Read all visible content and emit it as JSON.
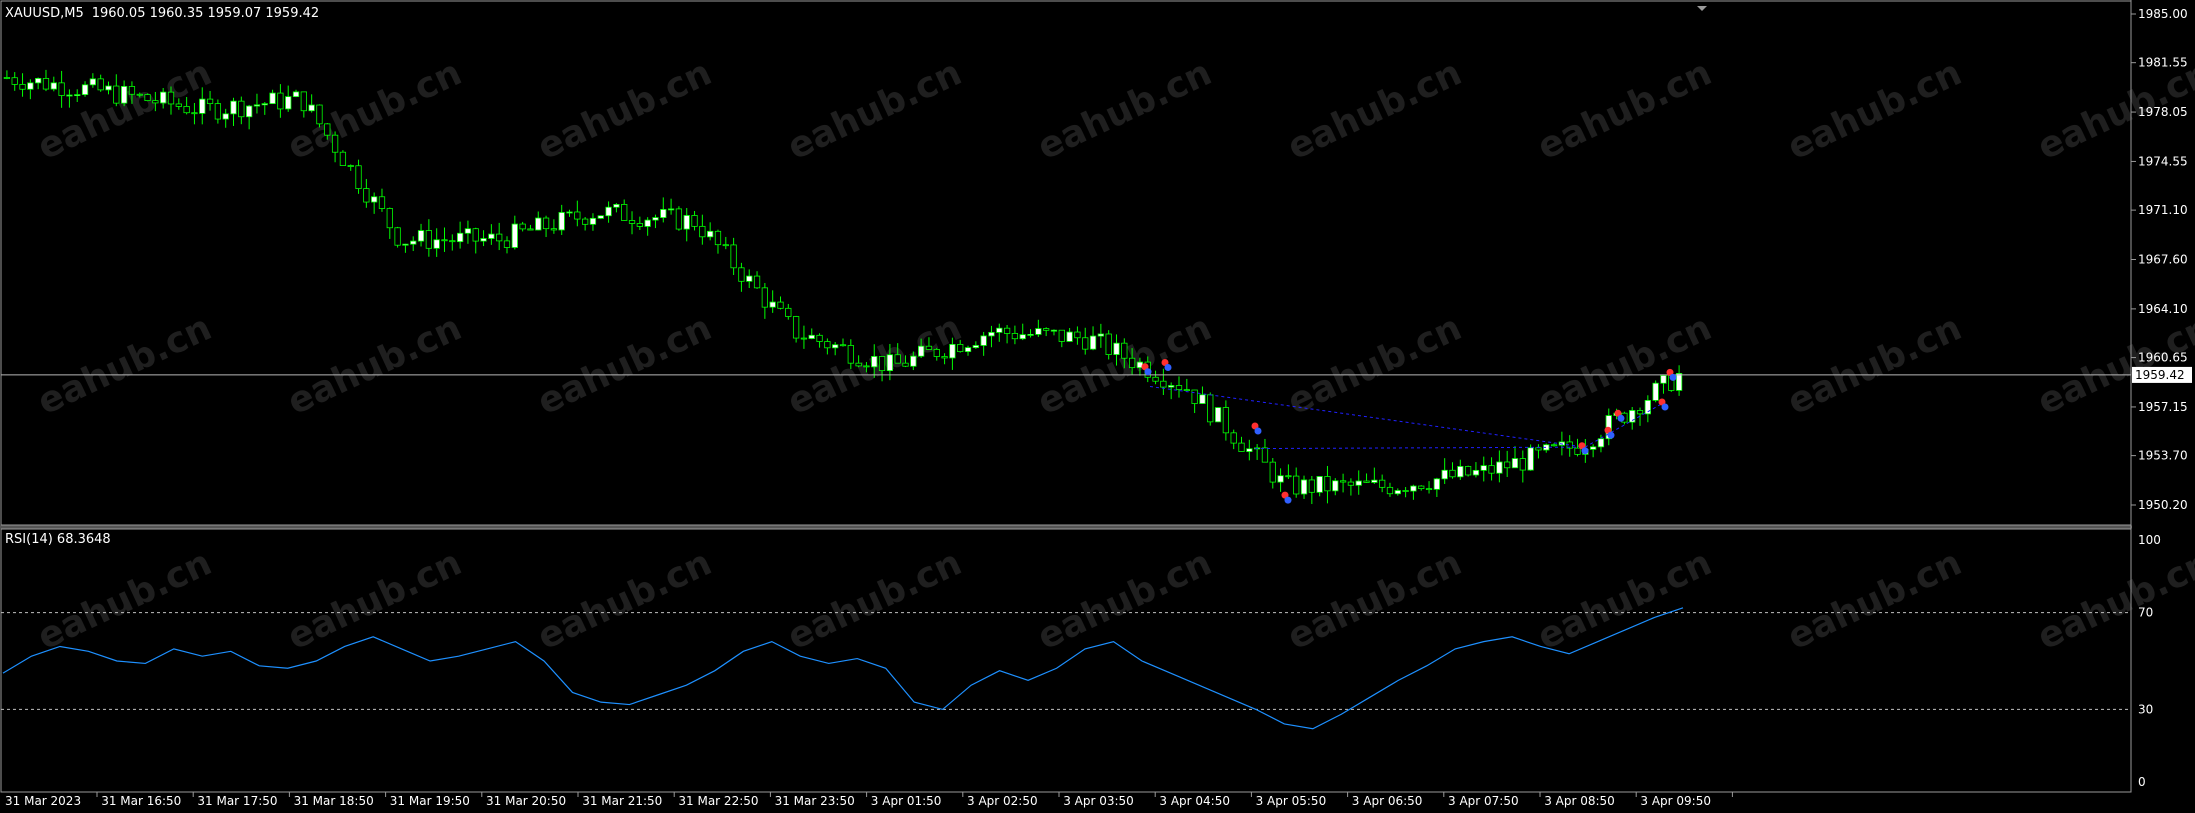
{
  "header": {
    "symbol": "XAUUSD,M5",
    "ohlc": "1960.05 1960.35 1959.07 1959.42"
  },
  "price_axis": {
    "ticks": [
      "1985.00",
      "1981.55",
      "1978.05",
      "1974.55",
      "1971.10",
      "1967.60",
      "1964.10",
      "1960.65",
      "1957.15",
      "1953.70",
      "1950.20"
    ],
    "current_label": "1959.42"
  },
  "rsi": {
    "title": "RSI(14) 68.3648",
    "ticks": [
      "100",
      "70",
      "30",
      "0"
    ]
  },
  "time_axis": {
    "labels": [
      "31 Mar 2023",
      "31 Mar 16:50",
      "31 Mar 17:50",
      "31 Mar 18:50",
      "31 Mar 19:50",
      "31 Mar 20:50",
      "31 Mar 21:50",
      "31 Mar 22:50",
      "31 Mar 23:50",
      "3 Apr 01:50",
      "3 Apr 02:50",
      "3 Apr 03:50",
      "3 Apr 04:50",
      "3 Apr 05:50",
      "3 Apr 06:50",
      "3 Apr 07:50",
      "3 Apr 08:50",
      "3 Apr 09:50"
    ]
  },
  "watermark": "eahub.cn",
  "colors": {
    "background": "#000000",
    "bull_candle": "#ffffff",
    "candle_outline": "#00ff00",
    "rsi_line": "#1e90ff",
    "grid_level": "#c0c0c0",
    "trade_line": "#2020ff"
  },
  "chart_data": [
    {
      "type": "candlestick",
      "title": "XAUUSD,M5",
      "ylim": [
        1950.2,
        1985.0
      ],
      "current_price": 1959.42,
      "trend_points": [
        {
          "t": "31 Mar 2023",
          "y": 1980.5
        },
        {
          "t": "31 Mar 16:50",
          "y": 1979.5
        },
        {
          "t": "31 Mar 17:50",
          "y": 1978.2
        },
        {
          "t": "31 Mar 18:50",
          "y": 1979.0
        },
        {
          "t": "31 Mar 19:50",
          "y": 1969.0
        },
        {
          "t": "31 Mar 20:50",
          "y": 1969.0
        },
        {
          "t": "31 Mar 21:50",
          "y": 1971.0
        },
        {
          "t": "31 Mar 22:50",
          "y": 1970.3
        },
        {
          "t": "31 Mar 23:50",
          "y": 1962.5
        },
        {
          "t": "3 Apr 01:50",
          "y": 1960.0
        },
        {
          "t": "3 Apr 02:50",
          "y": 1962.5
        },
        {
          "t": "3 Apr 03:50",
          "y": 1962.0
        },
        {
          "t": "3 Apr 04:50",
          "y": 1958.5
        },
        {
          "t": "3 Apr 05:50",
          "y": 1951.5
        },
        {
          "t": "3 Apr 06:50",
          "y": 1951.5
        },
        {
          "t": "3 Apr 07:50",
          "y": 1952.5
        },
        {
          "t": "3 Apr 08:50",
          "y": 1954.5
        },
        {
          "t": "3 Apr 09:50",
          "y": 1959.4
        }
      ]
    },
    {
      "type": "line",
      "title": "RSI(14) 68.3648",
      "ylim": [
        0,
        100
      ],
      "levels": [
        30,
        70
      ],
      "series": [
        {
          "name": "RSI(14)",
          "values": [
            45,
            52,
            56,
            54,
            50,
            49,
            55,
            52,
            54,
            48,
            47,
            50,
            56,
            60,
            55,
            50,
            52,
            55,
            58,
            50,
            37,
            33,
            32,
            36,
            40,
            46,
            54,
            58,
            52,
            49,
            51,
            47,
            33,
            30,
            40,
            46,
            42,
            47,
            55,
            58,
            50,
            45,
            40,
            35,
            30,
            24,
            22,
            28,
            35,
            42,
            48,
            55,
            58,
            60,
            56,
            53,
            58,
            63,
            68,
            72
          ]
        }
      ]
    }
  ]
}
